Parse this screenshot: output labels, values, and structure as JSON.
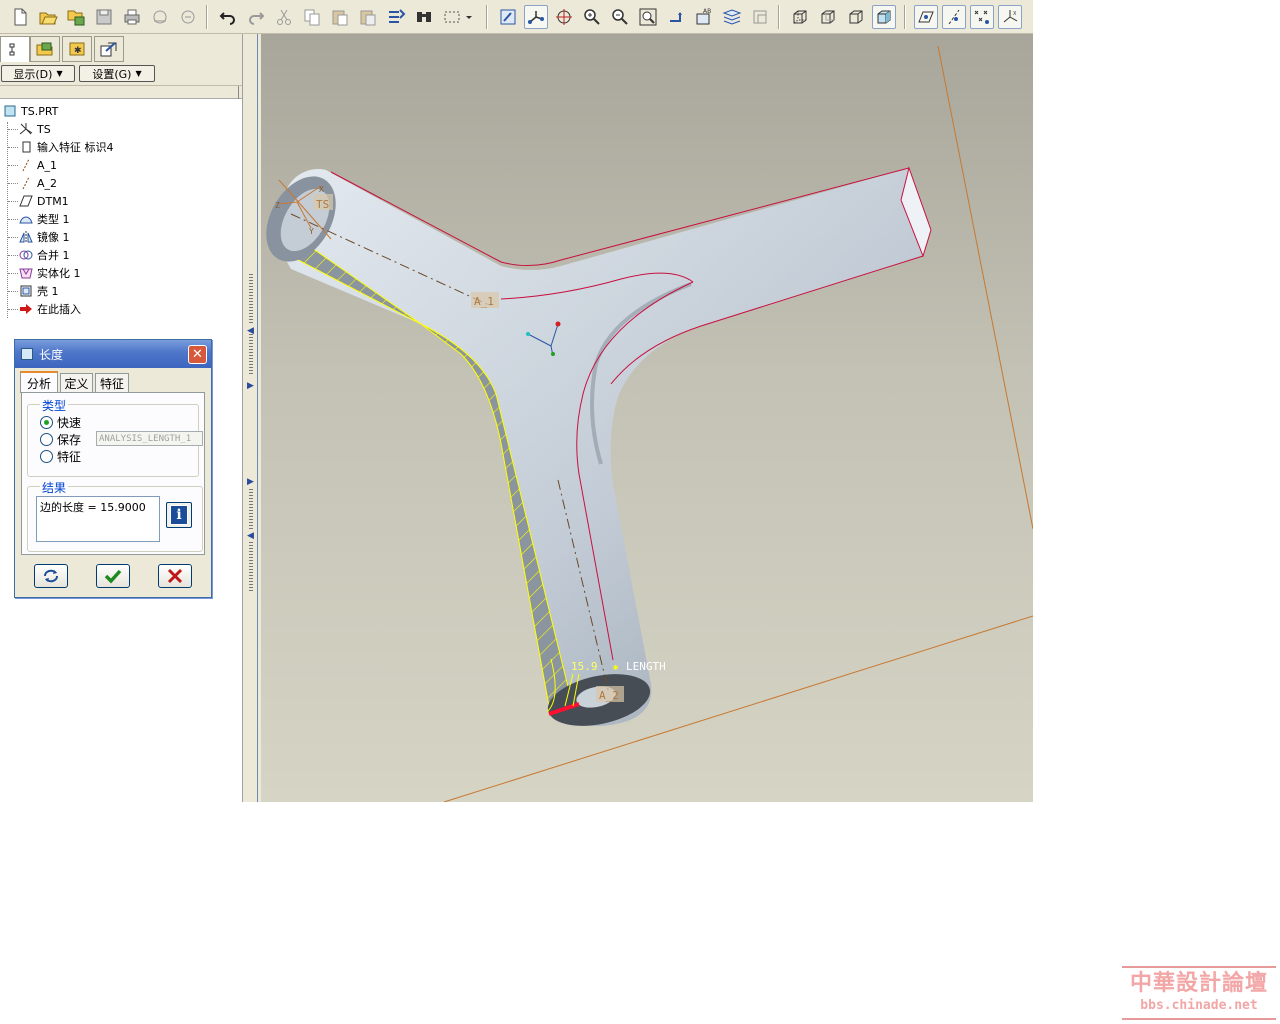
{
  "panel": {
    "show_menu": "显示(D)",
    "settings_menu": "设置(G)"
  },
  "model_tree": {
    "items": [
      {
        "label": "TS.PRT",
        "icon": "part-icon"
      },
      {
        "label": "TS",
        "icon": "csys-icon"
      },
      {
        "label": "输入特征 标识4",
        "icon": "import-feature-icon"
      },
      {
        "label": "A_1",
        "icon": "datum-axis-icon"
      },
      {
        "label": "A_2",
        "icon": "datum-axis-icon"
      },
      {
        "label": "DTM1",
        "icon": "datum-plane-icon"
      },
      {
        "label": "类型 1",
        "icon": "surface-icon"
      },
      {
        "label": "镜像 1",
        "icon": "mirror-icon"
      },
      {
        "label": "合并 1",
        "icon": "merge-icon"
      },
      {
        "label": "实体化 1",
        "icon": "solidify-icon"
      },
      {
        "label": "壳 1",
        "icon": "shell-icon"
      },
      {
        "label": "在此插入",
        "icon": "insert-here-arrow-icon"
      }
    ]
  },
  "dialog": {
    "title": "长度",
    "close": "✕",
    "tabs": [
      "分析",
      "定义",
      "特征"
    ],
    "type_group": {
      "title": "类型",
      "options": [
        "快速",
        "保存",
        "特征"
      ],
      "selected": "快速",
      "save_placeholder": "ANALYSIS_LENGTH_1"
    },
    "result_group": {
      "title": "结果",
      "text": "边的长度 = 15.9000",
      "info_label": "i"
    }
  },
  "viewport": {
    "label_ts": "TS",
    "label_x": "X",
    "label_y": "Y",
    "label_z": "Z",
    "label_a1": "A_1",
    "label_a2": "A_2",
    "label_length_value": "15.9",
    "label_length_name": "LENGTH"
  },
  "watermark": {
    "title": "中華設計論壇",
    "url": "bbs.chinade.net"
  },
  "colors": {
    "toolbar_bg": "#ece9d8",
    "model_fill": "#c9d3dc",
    "edge_highlight": "#c8103e",
    "selection_yellow": "#ffff00",
    "datum_orange": "#c87830",
    "dialog_titlebar": "#4d75c9"
  }
}
